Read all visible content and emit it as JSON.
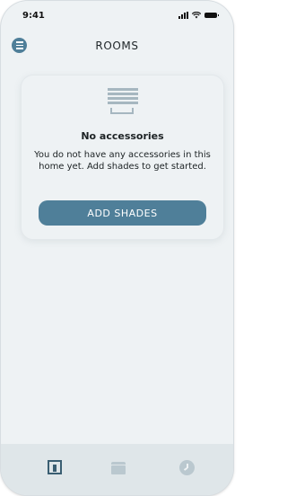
{
  "status_bar": {
    "time": "9:41",
    "icons": [
      "signal-icon",
      "wifi-icon",
      "battery-icon"
    ]
  },
  "header": {
    "title": "ROOMS",
    "menu_icon": "menu-icon"
  },
  "empty_state": {
    "icon": "window-shade-icon",
    "title": "No accessories",
    "message": "You do not have any accessories in this home yet. Add shades to get started.",
    "button_label": "ADD SHADES"
  },
  "tab_bar": {
    "tabs": [
      {
        "icon": "door-icon",
        "active": true
      },
      {
        "icon": "shade-icon",
        "active": false
      },
      {
        "icon": "clock-icon",
        "active": false
      }
    ]
  },
  "colors": {
    "accent": "#4f7f99",
    "background": "#eef2f4",
    "tab_bar": "#dfe6e9",
    "inactive_icon": "#bac8cf"
  }
}
